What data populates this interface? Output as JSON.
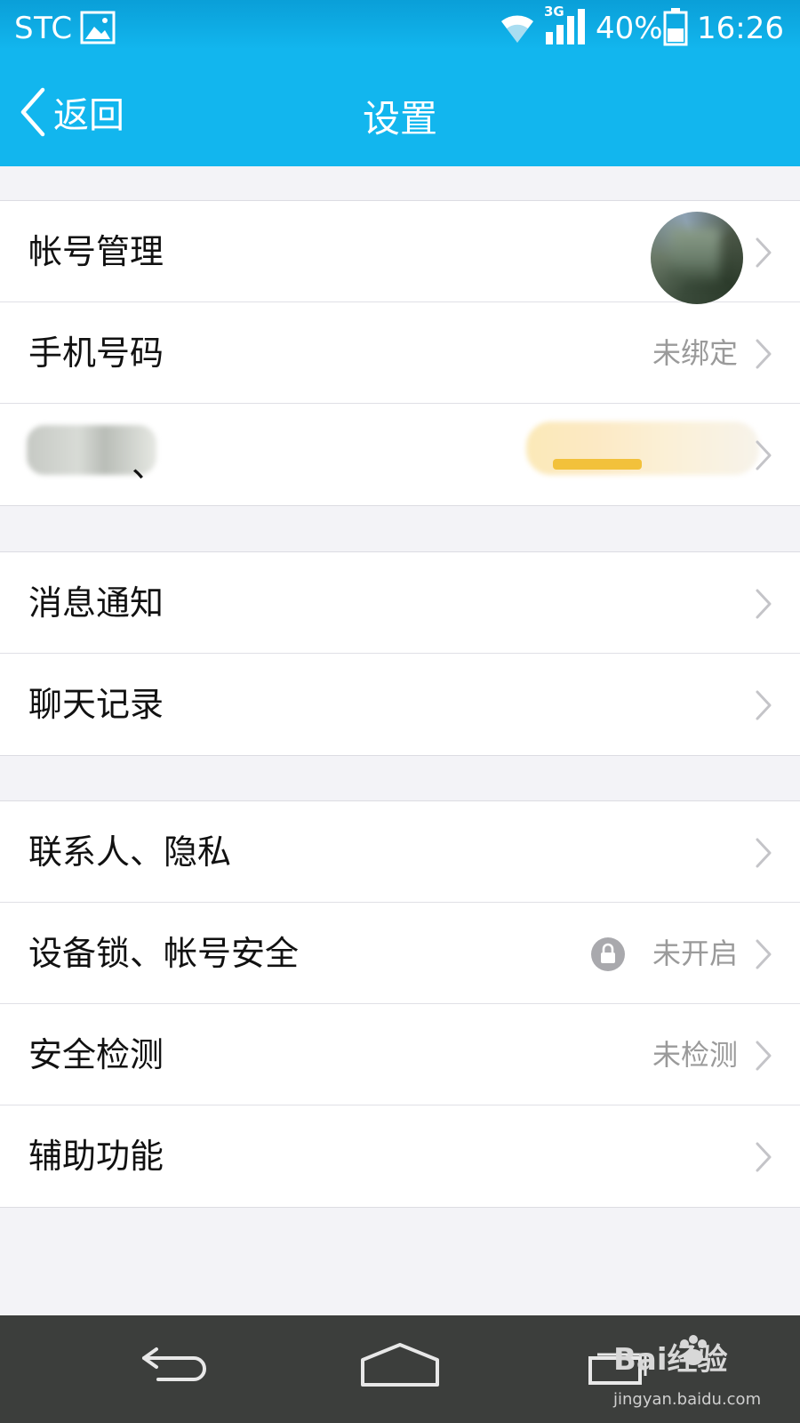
{
  "status_bar": {
    "carrier": "STC",
    "network_type": "3G",
    "battery_percent": "40%",
    "time": "16:26"
  },
  "nav": {
    "back_label": "返回",
    "title": "设置"
  },
  "groups": [
    {
      "rows": [
        {
          "label": "帐号管理",
          "value": "",
          "has_avatar": true
        },
        {
          "label": "手机号码",
          "value": "未绑定"
        },
        {
          "label": "",
          "label_tail": "、",
          "value": "",
          "blurred": true
        }
      ]
    },
    {
      "rows": [
        {
          "label": "消息通知",
          "value": ""
        },
        {
          "label": "聊天记录",
          "value": ""
        }
      ]
    },
    {
      "rows": [
        {
          "label": "联系人、隐私",
          "value": ""
        },
        {
          "label": "设备锁、帐号安全",
          "value": "未开启",
          "icon": "lock-icon"
        },
        {
          "label": "安全检测",
          "value": "未检测"
        },
        {
          "label": "辅助功能",
          "value": ""
        }
      ]
    }
  ],
  "bottom_nav": {
    "buttons": [
      "back-icon",
      "home-icon",
      "recent-apps-icon"
    ]
  },
  "watermark": {
    "text": "Bai经验",
    "sub": "jingyan.baidu.com"
  },
  "colors": {
    "header": "#12b6ee",
    "status_dark": "#0a9fd8",
    "background": "#f3f3f7",
    "value_gray": "#9a9a9a",
    "bottom_bar": "#3c3e3c"
  }
}
